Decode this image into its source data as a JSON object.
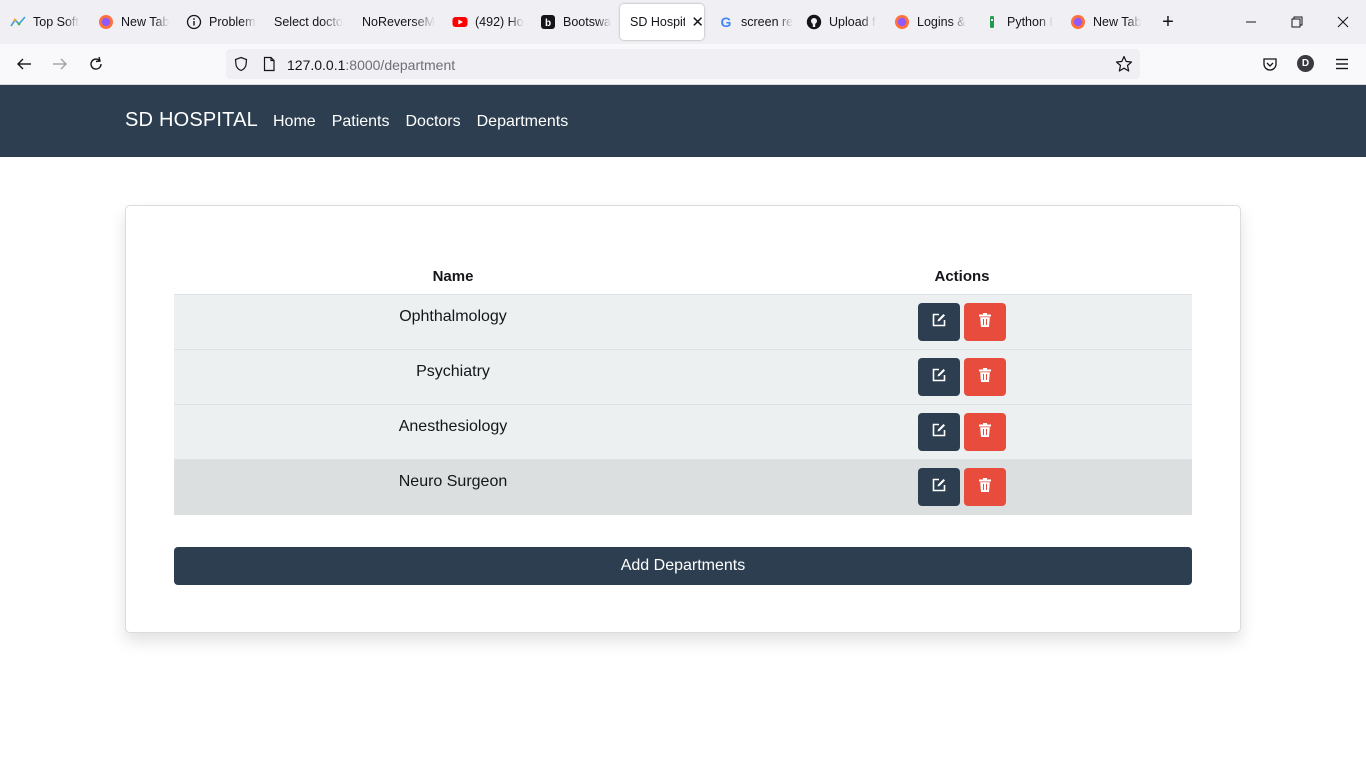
{
  "browser": {
    "tabs": [
      {
        "title": "Top Soft",
        "icon": "chart-favicon-icon"
      },
      {
        "title": "New Tab",
        "icon": "firefox-icon"
      },
      {
        "title": "Problem",
        "icon": "info-icon"
      },
      {
        "title": "Select docto",
        "icon": "blank-page-icon"
      },
      {
        "title": "NoReverseM",
        "icon": "blank-page-icon"
      },
      {
        "title": "(492) Ho",
        "icon": "youtube-icon"
      },
      {
        "title": "Bootswa",
        "icon": "bootswatch-icon"
      },
      {
        "title": "SD Hospit",
        "icon": "blank-page-icon",
        "active": true
      },
      {
        "title": "screen re",
        "icon": "google-icon"
      },
      {
        "title": "Upload f",
        "icon": "github-icon"
      },
      {
        "title": "Logins &",
        "icon": "firefox-icon"
      },
      {
        "title": "Python I",
        "icon": "python-anywhere-icon"
      },
      {
        "title": "New Tab",
        "icon": "firefox-icon"
      }
    ],
    "url_host": "127.0.0.1",
    "url_rest": ":8000/department",
    "avatar_letter": "D"
  },
  "app": {
    "brand": "SD HOSPITAL",
    "nav": [
      "Home",
      "Patients",
      "Doctors",
      "Departments"
    ]
  },
  "table": {
    "headers": {
      "name": "Name",
      "actions": "Actions"
    },
    "rows": [
      {
        "name": "Ophthalmology"
      },
      {
        "name": "Psychiatry"
      },
      {
        "name": "Anesthesiology"
      },
      {
        "name": "Neuro Surgeon"
      }
    ]
  },
  "add_button_label": "Add Departments",
  "colors": {
    "primary": "#2c3e50",
    "danger": "#e74c3c",
    "row_bg": "#ecf0f1",
    "row_hover_bg": "#dcdfe0"
  }
}
